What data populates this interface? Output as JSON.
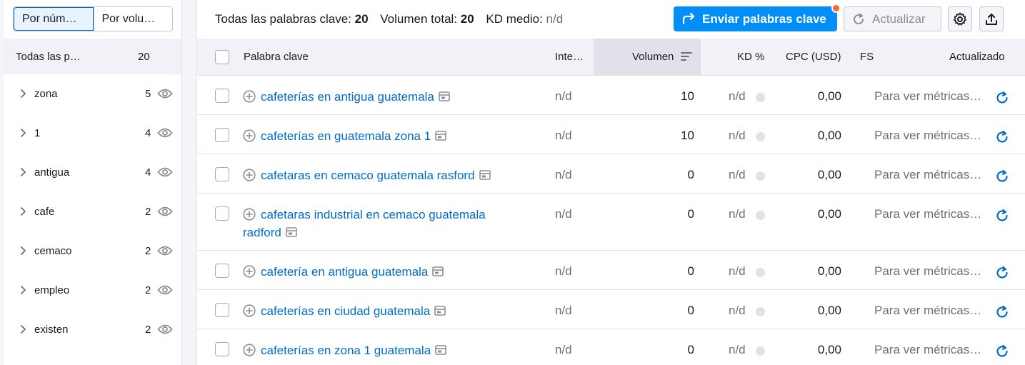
{
  "sidebar": {
    "toggle": {
      "by_number": "Por núm…",
      "by_volume": "Por volu…"
    },
    "all_label": "Todas las p…",
    "all_count": "20",
    "groups": [
      {
        "label": "zona",
        "count": "5"
      },
      {
        "label": "1",
        "count": "4"
      },
      {
        "label": "antigua",
        "count": "4"
      },
      {
        "label": "cafe",
        "count": "2"
      },
      {
        "label": "cemaco",
        "count": "2"
      },
      {
        "label": "empleo",
        "count": "2"
      },
      {
        "label": "existen",
        "count": "2"
      }
    ]
  },
  "summary": {
    "all_keywords_label": "Todas las palabras clave:",
    "all_keywords_value": "20",
    "total_volume_label": "Volumen total:",
    "total_volume_value": "20",
    "avg_kd_label": "KD medio:",
    "avg_kd_value": "n/d"
  },
  "toolbar": {
    "send_label": "Enviar palabras clave",
    "update_label": "Actualizar"
  },
  "table": {
    "columns": {
      "keyword": "Palabra clave",
      "intent": "Inte…",
      "volume": "Volumen",
      "kd": "KD %",
      "cpc": "CPC (USD)",
      "fs": "FS",
      "updated": "Actualizado"
    },
    "rows": [
      {
        "keyword": "cafeterías en antigua guatemala",
        "intent": "n/d",
        "volume": "10",
        "kd": "n/d",
        "cpc": "0,00",
        "updated": "Para ver métricas…"
      },
      {
        "keyword": "cafeterías en guatemala zona 1",
        "intent": "n/d",
        "volume": "10",
        "kd": "n/d",
        "cpc": "0,00",
        "updated": "Para ver métricas…"
      },
      {
        "keyword": "cafetaras en cemaco guatemala rasford",
        "intent": "n/d",
        "volume": "0",
        "kd": "n/d",
        "cpc": "0,00",
        "updated": "Para ver métricas…"
      },
      {
        "keyword": "cafetaras industrial en cemaco guatemala radford",
        "intent": "n/d",
        "volume": "0",
        "kd": "n/d",
        "cpc": "0,00",
        "updated": "Para ver métricas…"
      },
      {
        "keyword": "cafetería en antigua guatemala",
        "intent": "n/d",
        "volume": "0",
        "kd": "n/d",
        "cpc": "0,00",
        "updated": "Para ver métricas…"
      },
      {
        "keyword": "cafeterías en ciudad guatemala",
        "intent": "n/d",
        "volume": "0",
        "kd": "n/d",
        "cpc": "0,00",
        "updated": "Para ver métricas…"
      },
      {
        "keyword": "cafeterías en zona 1 guatemala",
        "intent": "n/d",
        "volume": "0",
        "kd": "n/d",
        "cpc": "0,00",
        "updated": "Para ver métricas…"
      }
    ]
  },
  "colors": {
    "accent": "#008ff8",
    "link": "#006dca",
    "notification": "#ff642d"
  }
}
